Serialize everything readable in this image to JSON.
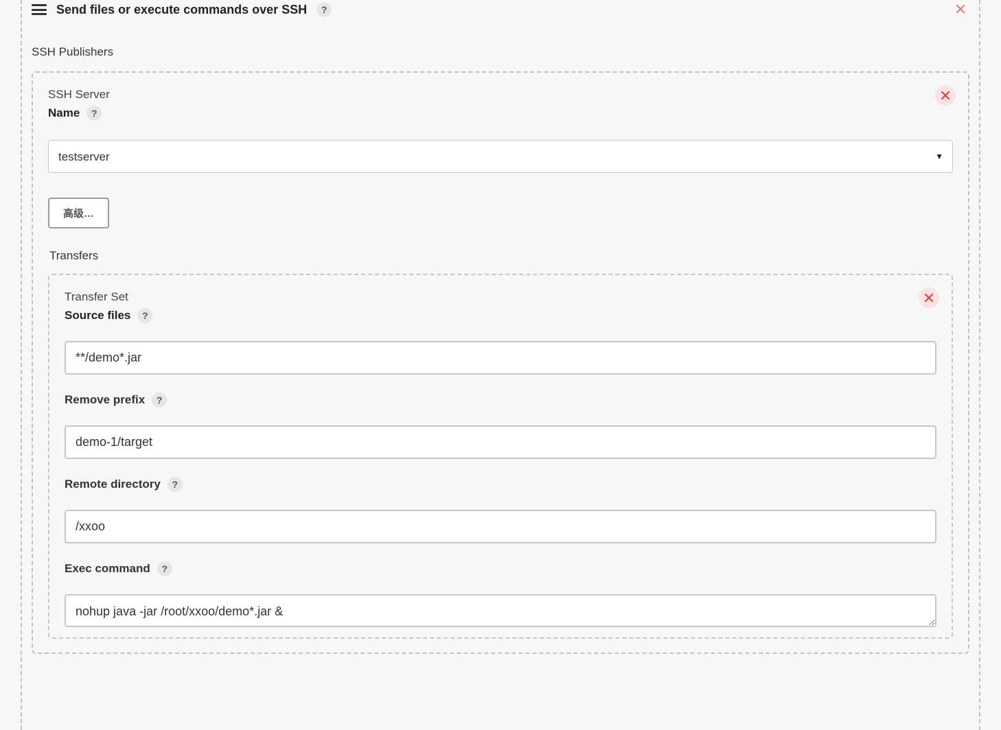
{
  "header": {
    "title": "Send files or execute commands over SSH"
  },
  "ssh_publishers_label": "SSH Publishers",
  "ssh_server": {
    "group_label": "SSH Server",
    "name_label": "Name",
    "selected": "testserver",
    "options": [
      "testserver"
    ]
  },
  "advanced_button": "高级…",
  "transfers_label": "Transfers",
  "transfer_set": {
    "group_label": "Transfer Set",
    "source_files": {
      "label": "Source files",
      "value": "**/demo*.jar"
    },
    "remove_prefix": {
      "label": "Remove prefix",
      "value": "demo-1/target"
    },
    "remote_directory": {
      "label": "Remote directory",
      "value": "/xxoo"
    },
    "exec_command": {
      "label": "Exec command",
      "value": "nohup java -jar /root/xxoo/demo*.jar &"
    }
  },
  "icons": {
    "help": "?",
    "close": "close-icon",
    "hamburger": "drag-handle-icon",
    "caret": "▼"
  }
}
